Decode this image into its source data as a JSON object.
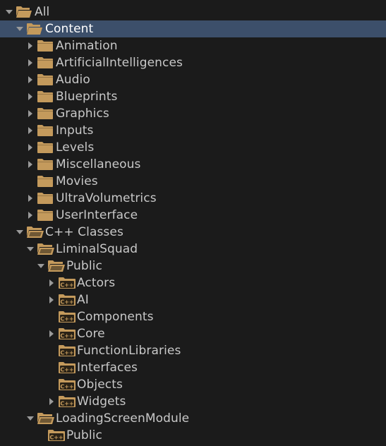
{
  "colors": {
    "background": "#1b1b1b",
    "selected_row": "#3c4f6a",
    "folder": "#c49a5c",
    "text": "#c8c8c8",
    "arrow": "#9a9a9a"
  },
  "tree": [
    {
      "label": "All",
      "depth": 0,
      "arrow": "expanded",
      "icon": "folder-open-icon",
      "name": "all"
    },
    {
      "label": "Content",
      "depth": 1,
      "arrow": "expanded",
      "icon": "folder-open-icon",
      "name": "content",
      "selected": true
    },
    {
      "label": "Animation",
      "depth": 2,
      "arrow": "collapsed",
      "icon": "folder-icon",
      "name": "animation"
    },
    {
      "label": "ArtificialIntelligences",
      "depth": 2,
      "arrow": "collapsed",
      "icon": "folder-icon",
      "name": "artificial-intelligences"
    },
    {
      "label": "Audio",
      "depth": 2,
      "arrow": "collapsed",
      "icon": "folder-icon",
      "name": "audio"
    },
    {
      "label": "Blueprints",
      "depth": 2,
      "arrow": "collapsed",
      "icon": "folder-icon",
      "name": "blueprints"
    },
    {
      "label": "Graphics",
      "depth": 2,
      "arrow": "collapsed",
      "icon": "folder-icon",
      "name": "graphics"
    },
    {
      "label": "Inputs",
      "depth": 2,
      "arrow": "collapsed",
      "icon": "folder-icon",
      "name": "inputs"
    },
    {
      "label": "Levels",
      "depth": 2,
      "arrow": "collapsed",
      "icon": "folder-icon",
      "name": "levels"
    },
    {
      "label": "Miscellaneous",
      "depth": 2,
      "arrow": "collapsed",
      "icon": "folder-icon",
      "name": "miscellaneous"
    },
    {
      "label": "Movies",
      "depth": 2,
      "arrow": "none",
      "icon": "folder-icon",
      "name": "movies"
    },
    {
      "label": "UltraVolumetrics",
      "depth": 2,
      "arrow": "collapsed",
      "icon": "folder-icon",
      "name": "ultra-volumetrics"
    },
    {
      "label": "UserInterface",
      "depth": 2,
      "arrow": "collapsed",
      "icon": "folder-icon",
      "name": "user-interface"
    },
    {
      "label": "C++ Classes",
      "depth": 1,
      "arrow": "expanded",
      "icon": "cpp-folder-open-icon",
      "name": "cpp-classes"
    },
    {
      "label": "LiminalSquad",
      "depth": 2,
      "arrow": "expanded",
      "icon": "cpp-folder-open-icon",
      "name": "liminal-squad"
    },
    {
      "label": "Public",
      "depth": 3,
      "arrow": "expanded",
      "icon": "cpp-folder-open-icon",
      "name": "liminal-squad-public"
    },
    {
      "label": "Actors",
      "depth": 4,
      "arrow": "collapsed",
      "icon": "cpp-folder-icon",
      "name": "actors"
    },
    {
      "label": "AI",
      "depth": 4,
      "arrow": "collapsed",
      "icon": "cpp-folder-icon",
      "name": "ai"
    },
    {
      "label": "Components",
      "depth": 4,
      "arrow": "none",
      "icon": "cpp-folder-icon",
      "name": "components"
    },
    {
      "label": "Core",
      "depth": 4,
      "arrow": "collapsed",
      "icon": "cpp-folder-icon",
      "name": "core"
    },
    {
      "label": "FunctionLibraries",
      "depth": 4,
      "arrow": "none",
      "icon": "cpp-folder-icon",
      "name": "function-libraries"
    },
    {
      "label": "Interfaces",
      "depth": 4,
      "arrow": "none",
      "icon": "cpp-folder-icon",
      "name": "interfaces"
    },
    {
      "label": "Objects",
      "depth": 4,
      "arrow": "none",
      "icon": "cpp-folder-icon",
      "name": "objects"
    },
    {
      "label": "Widgets",
      "depth": 4,
      "arrow": "collapsed",
      "icon": "cpp-folder-icon",
      "name": "widgets"
    },
    {
      "label": "LoadingScreenModule",
      "depth": 2,
      "arrow": "expanded",
      "icon": "cpp-folder-open-icon",
      "name": "loading-screen-module"
    },
    {
      "label": "Public",
      "depth": 3,
      "arrow": "none",
      "icon": "cpp-folder-icon",
      "name": "loading-screen-public"
    }
  ]
}
